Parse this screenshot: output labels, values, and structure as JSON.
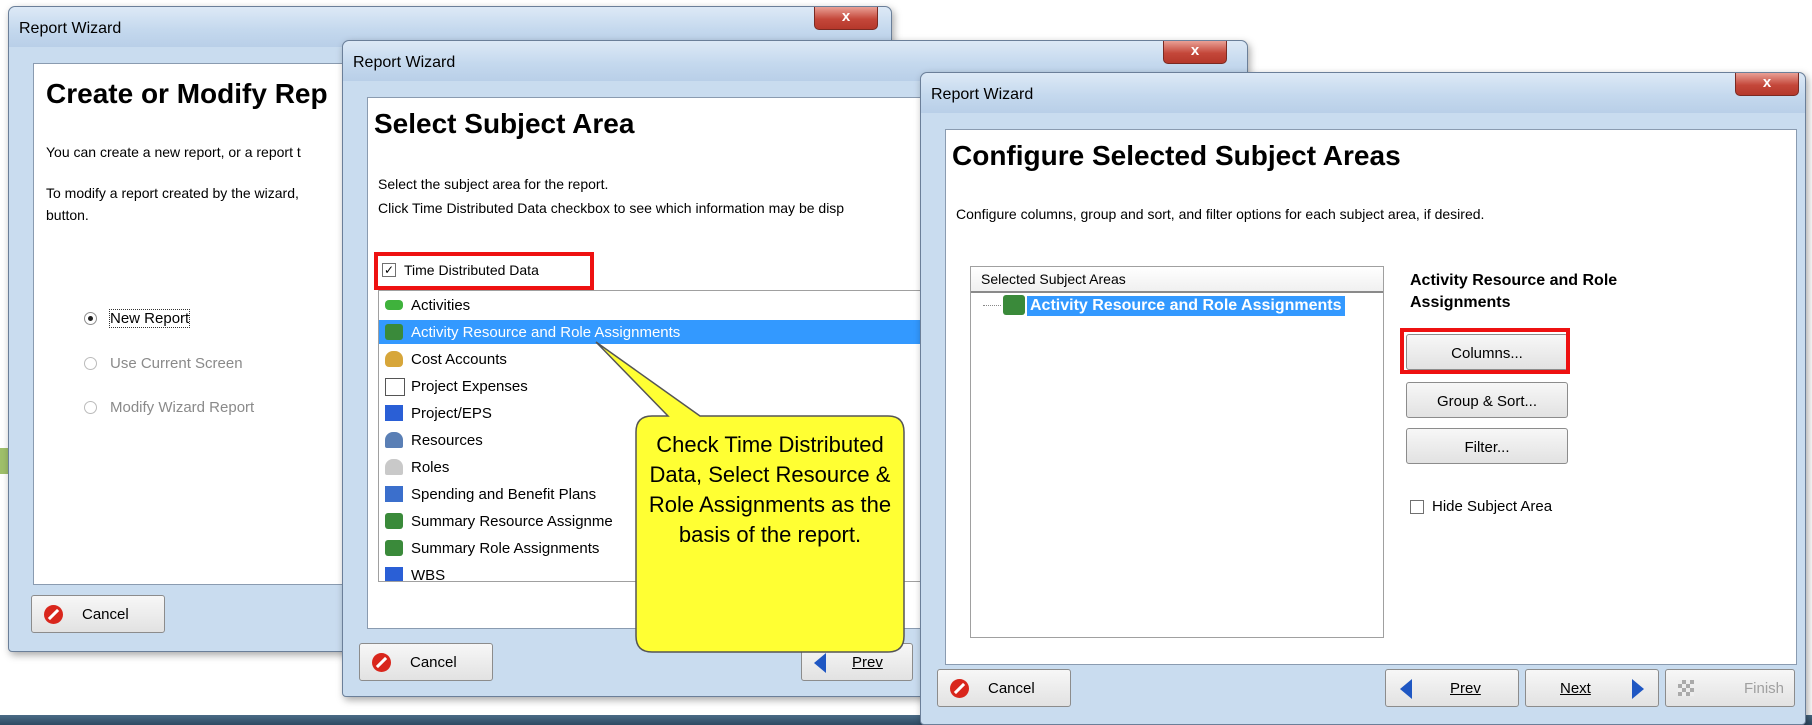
{
  "window1": {
    "title": "Report Wizard",
    "close": "x",
    "heading": "Create or Modify Rep",
    "desc1": "You can create a new report, or a report t",
    "desc2a": "To modify a report created by the wizard,",
    "desc2b": "button.",
    "options": [
      "New Report",
      "Use Current Screen",
      "Modify Wizard Report"
    ],
    "cancel": "Cancel"
  },
  "window2": {
    "title": "Report Wizard",
    "close": "x",
    "heading": "Select Subject Area",
    "desc1": "Select the subject area for the report.",
    "desc2": "Click Time Distributed Data checkbox to see which information may be disp",
    "checkbox_label": "Time Distributed Data",
    "checkbox_mark": "✓",
    "items": [
      {
        "label": "Activities",
        "icon": "activities-icon"
      },
      {
        "label": "Activity Resource and Role Assignments",
        "icon": "assignments-icon"
      },
      {
        "label": "Cost Accounts",
        "icon": "cost-accounts-icon"
      },
      {
        "label": "Project Expenses",
        "icon": "expenses-icon"
      },
      {
        "label": "Project/EPS",
        "icon": "project-eps-icon"
      },
      {
        "label": "Resources",
        "icon": "resources-icon"
      },
      {
        "label": "Roles",
        "icon": "roles-icon"
      },
      {
        "label": "Spending and Benefit Plans",
        "icon": "spending-icon"
      },
      {
        "label": "Summary Resource Assignme",
        "icon": "summary-resource-icon"
      },
      {
        "label": "Summary Role Assignments",
        "icon": "summary-role-icon"
      },
      {
        "label": "WBS",
        "icon": "wbs-icon"
      }
    ],
    "cancel": "Cancel",
    "prev": "Prev"
  },
  "callout": {
    "text": "Check Time Distributed Data, Select Resource & Role Assignments as the basis of the report."
  },
  "window3": {
    "title": "Report Wizard",
    "close": "x",
    "heading": "Configure Selected Subject Areas",
    "desc": "Configure columns, group and sort, and filter options for each subject area, if desired.",
    "tree_header": "Selected Subject Areas",
    "tree_item": "Activity Resource and Role Assignments",
    "side_title": "Activity Resource and Role Assignments",
    "columns": "Columns...",
    "group_sort": "Group & Sort...",
    "filter": "Filter...",
    "hide_label": "Hide Subject Area",
    "cancel": "Cancel",
    "prev": "Prev",
    "next": "Next",
    "finish": "Finish"
  },
  "colors": {
    "highlight": "#ee1111",
    "selection": "#3399ff",
    "callout_fill": "#ffff33"
  }
}
